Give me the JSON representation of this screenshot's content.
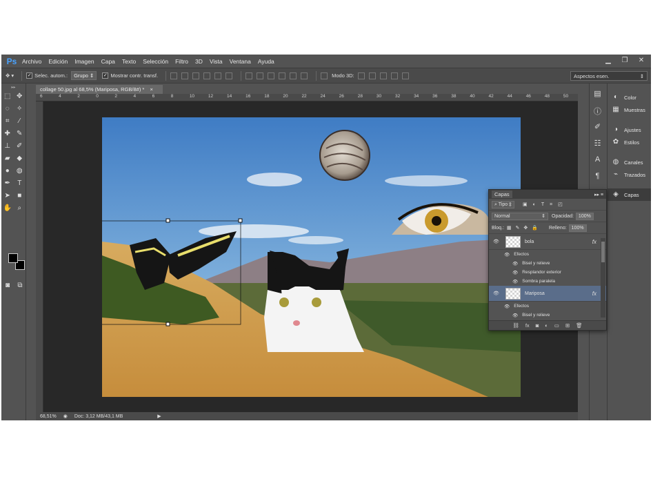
{
  "app": {
    "logo": "Ps"
  },
  "menu": [
    "Archivo",
    "Edición",
    "Imagen",
    "Capa",
    "Texto",
    "Selección",
    "Filtro",
    "3D",
    "Vista",
    "Ventana",
    "Ayuda"
  ],
  "options": {
    "auto_select_label": "Selec. autom.:",
    "group_value": "Grupo",
    "transform_label": "Mostrar contr. transf.",
    "mode3d_label": "Modo 3D:",
    "workspace": "Aspectos esen."
  },
  "document": {
    "tab_title": "collage 50.jpg al 68,5% (Mariposa, RGB/8#) *",
    "ruler_numbers": [
      "6",
      "4",
      "2",
      "0",
      "2",
      "4",
      "6",
      "8",
      "10",
      "12",
      "14",
      "16",
      "18",
      "20",
      "22",
      "24",
      "26",
      "28",
      "30",
      "32",
      "34",
      "36",
      "38",
      "40",
      "42",
      "44",
      "46",
      "48",
      "50"
    ]
  },
  "status": {
    "zoom": "68,51%",
    "doc_size": "Doc: 3,12 MB/43,1 MB"
  },
  "dock": {
    "items": [
      {
        "icon": "color-icon",
        "label": "Color"
      },
      {
        "icon": "swatches-icon",
        "label": "Muestras"
      },
      {
        "icon": "adjustments-icon",
        "label": "Ajustes"
      },
      {
        "icon": "styles-icon",
        "label": "Estilos"
      },
      {
        "icon": "channels-icon",
        "label": "Canales"
      },
      {
        "icon": "paths-icon",
        "label": "Trazados"
      },
      {
        "icon": "layers-icon",
        "label": "Capas"
      }
    ]
  },
  "layers": {
    "title": "Capas",
    "filter": "Tipo",
    "blend_mode": "Normal",
    "opacity_label": "Opacidad:",
    "opacity": "100%",
    "lock_label": "Bloq.:",
    "fill_label": "Relleno:",
    "fill": "100%",
    "fx_symbol": "fx",
    "list": [
      {
        "name": "bola",
        "selected": false,
        "effects_label": "Efectos",
        "effects": [
          "Bisel y relieve",
          "Resplandor exterior",
          "Sombra paralela"
        ]
      },
      {
        "name": "Mariposa",
        "selected": true,
        "effects_label": "Efectos",
        "effects": [
          "Bisel y relieve"
        ]
      }
    ]
  },
  "colors": {
    "app_bg": "#535353",
    "pasteboard": "#282828",
    "selection": "#5a6d8a",
    "ps_blue": "#4aa3ff"
  }
}
